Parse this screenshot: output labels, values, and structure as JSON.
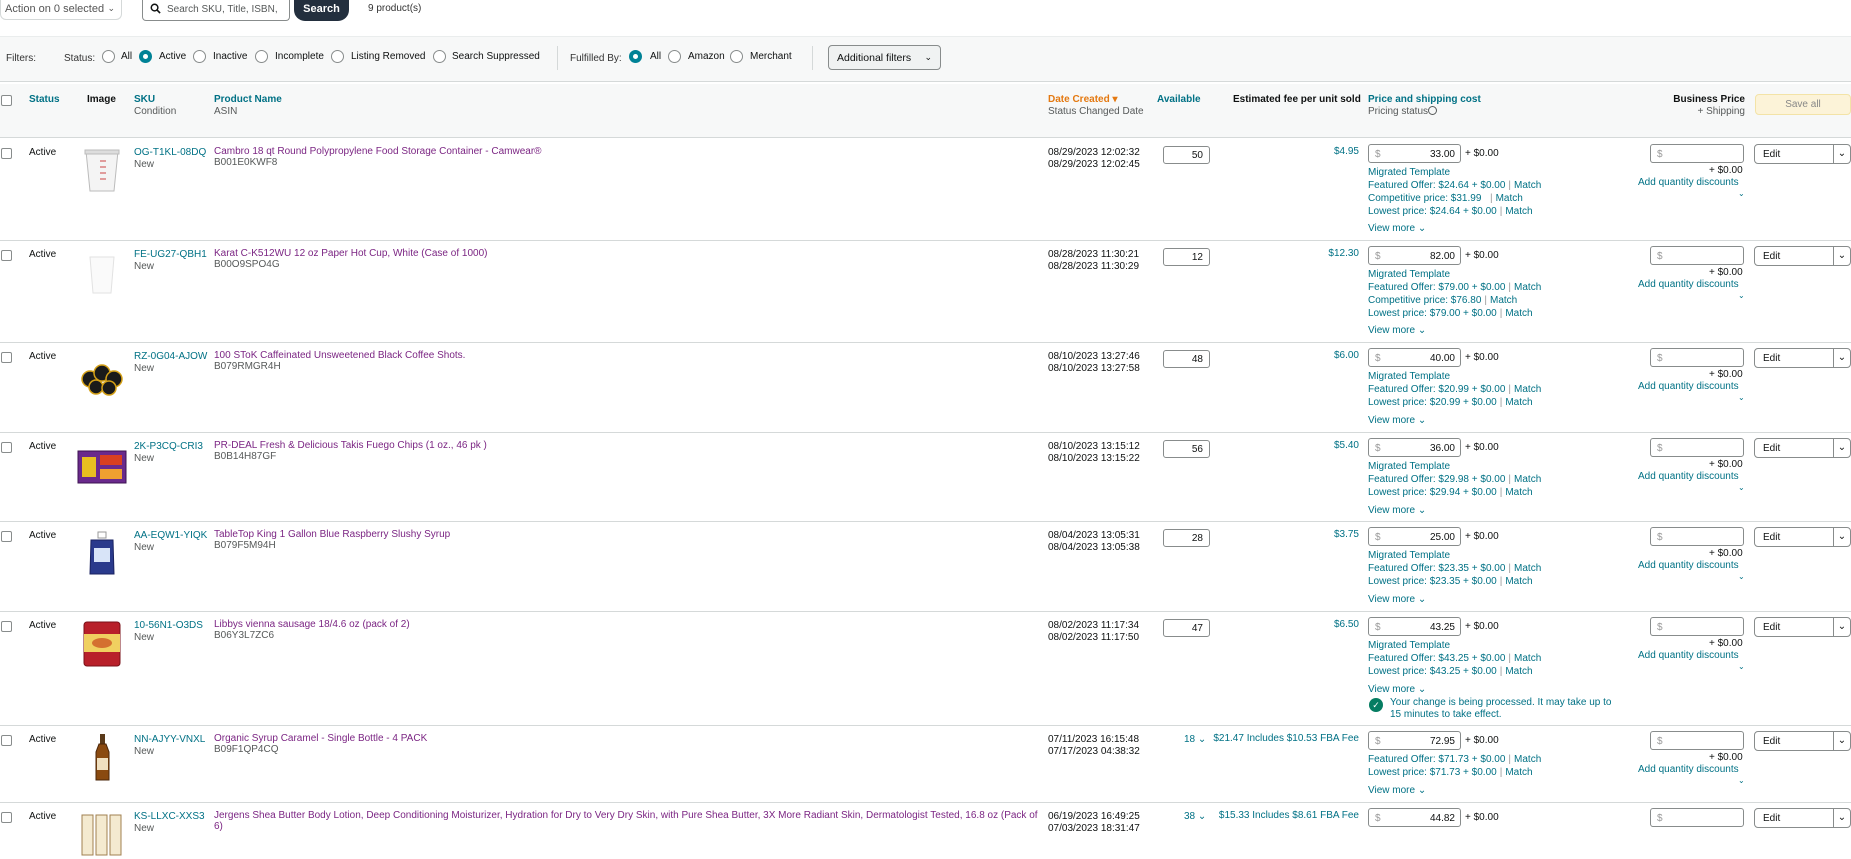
{
  "topbar": {
    "action_label": "Action on 0 selected",
    "search_placeholder": "Search SKU, Title, ISBN,",
    "search_button": "Search",
    "product_count": "9 product(s)"
  },
  "filters": {
    "label": "Filters:",
    "status_label": "Status:",
    "status_options": [
      "All",
      "Active",
      "Inactive",
      "Incomplete",
      "Listing Removed",
      "Search Suppressed"
    ],
    "status_selected": "Active",
    "fulfilled_label": "Fulfilled By:",
    "fulfilled_options": [
      "All",
      "Amazon",
      "Merchant"
    ],
    "fulfilled_selected": "All",
    "additional_button": "Additional filters"
  },
  "columns": {
    "status": "Status",
    "image": "Image",
    "sku": "SKU",
    "sku_sub": "Condition",
    "name": "Product Name",
    "name_sub": "ASIN",
    "date": "Date Created",
    "date_sub": "Status Changed Date",
    "available": "Available",
    "fee": "Estimated fee per unit sold",
    "price": "Price and shipping cost",
    "price_sub": "Pricing status",
    "business": "Business Price",
    "business_sub": "+ Shipping",
    "save_all": "Save all"
  },
  "common": {
    "dollar": "$",
    "plus_ship": "+ $0.00",
    "view_more": "View more",
    "add_discounts": "Add quantity discounts",
    "edit": "Edit",
    "match": "Match",
    "migrated": "Migrated Template"
  },
  "products": [
    {
      "status": "Active",
      "sku": "OG-T1KL-08DQ",
      "condition": "New",
      "name": "Cambro 18 qt Round Polypropylene Food Storage Container - Camwear®",
      "asin": "B001E0KWF8",
      "created": "08/29/2023 12:02:32",
      "changed": "08/29/2023 12:02:45",
      "available": "50",
      "fee": "$4.95",
      "price": "33.00",
      "featured": "Featured Offer: $24.64 + $0.00",
      "competitive": "Competitive price: $31.99",
      "lowest": "Lowest price: $24.64 + $0.00"
    },
    {
      "status": "Active",
      "sku": "FE-UG27-QBH1",
      "condition": "New",
      "name": "Karat C-K512WU 12 oz Paper Hot Cup, White (Case of 1000)",
      "asin": "B00O9SPO4G",
      "created": "08/28/2023 11:30:21",
      "changed": "08/28/2023 11:30:29",
      "available": "12",
      "fee": "$12.30",
      "price": "82.00",
      "featured": "Featured Offer: $79.00 + $0.00",
      "competitive": "Competitive price: $76.80",
      "lowest": "Lowest price: $79.00 + $0.00"
    },
    {
      "status": "Active",
      "sku": "RZ-0G04-AJOW",
      "condition": "New",
      "name": "100 SToK Caffeinated Unsweetened Black Coffee Shots.",
      "asin": "B079RMGR4H",
      "created": "08/10/2023 13:27:46",
      "changed": "08/10/2023 13:27:58",
      "available": "48",
      "fee": "$6.00",
      "price": "40.00",
      "featured": "Featured Offer: $20.99 + $0.00",
      "lowest": "Lowest price: $20.99 + $0.00"
    },
    {
      "status": "Active",
      "sku": "2K-P3CQ-CRI3",
      "condition": "New",
      "name": "PR-DEAL Fresh & Delicious Takis Fuego Chips (1 oz., 46 pk )",
      "asin": "B0B14H87GF",
      "created": "08/10/2023 13:15:12",
      "changed": "08/10/2023 13:15:22",
      "available": "56",
      "fee": "$5.40",
      "price": "36.00",
      "featured": "Featured Offer: $29.98 + $0.00",
      "lowest": "Lowest price: $29.94 + $0.00"
    },
    {
      "status": "Active",
      "sku": "AA-EQW1-YIQK",
      "condition": "New",
      "name": "TableTop King 1 Gallon Blue Raspberry Slushy Syrup",
      "asin": "B079F5M94H",
      "created": "08/04/2023 13:05:31",
      "changed": "08/04/2023 13:05:38",
      "available": "28",
      "fee": "$3.75",
      "price": "25.00",
      "featured": "Featured Offer: $23.35 + $0.00",
      "lowest": "Lowest price: $23.35 + $0.00"
    },
    {
      "status": "Active",
      "sku": "10-56N1-O3DS",
      "condition": "New",
      "name": "Libbys vienna sausage 18/4.6 oz (pack of 2)",
      "asin": "B06Y3L7ZC6",
      "created": "08/02/2023 11:17:34",
      "changed": "08/02/2023 11:17:50",
      "available": "47",
      "fee": "$6.50",
      "price": "43.25",
      "featured": "Featured Offer: $43.25 + $0.00",
      "lowest": "Lowest price: $43.25 + $0.00",
      "notice": "Your change is being processed. It may take up to 15 minutes to take effect."
    },
    {
      "status": "Active",
      "sku": "NN-AJYY-VNXL",
      "condition": "New",
      "name": "Organic Syrup Caramel - Single Bottle - 4 PACK",
      "asin": "B09F1QP4CQ",
      "created": "07/11/2023 16:15:48",
      "changed": "07/17/2023 04:38:32",
      "available": "18",
      "fee": "$21.47 Includes $10.53 FBA Fee",
      "price": "72.95",
      "featured": "Featured Offer: $71.73 + $0.00",
      "lowest": "Lowest price: $71.73 + $0.00"
    },
    {
      "status": "Active",
      "sku": "KS-LLXC-XXS3",
      "condition": "New",
      "name": "Jergens Shea Butter Body Lotion, Deep Conditioning Moisturizer, Hydration for Dry to Very Dry Skin, with Pure Shea Butter, 3X More Radiant Skin, Dermatologist Tested, 16.8 oz (Pack of 6)",
      "asin": "",
      "created": "06/19/2023 16:49:25",
      "changed": "07/03/2023 18:31:47",
      "available": "38",
      "fee": "$15.33 Includes $8.61 FBA Fee",
      "price": "44.82"
    }
  ]
}
